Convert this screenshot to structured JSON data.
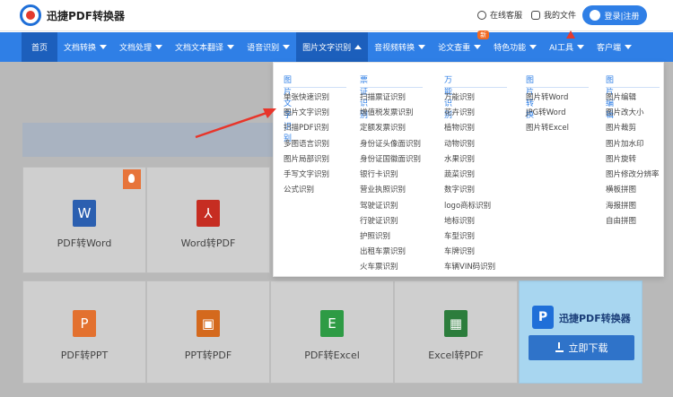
{
  "header": {
    "brand": "迅捷PDF转换器",
    "service": "在线客服",
    "my_files": "我的文件",
    "login": "登录|注册"
  },
  "nav": {
    "items": [
      {
        "label": "首页"
      },
      {
        "label": "文档转换"
      },
      {
        "label": "文档处理"
      },
      {
        "label": "文档文本翻译"
      },
      {
        "label": "语音识别"
      },
      {
        "label": "图片文字识别"
      },
      {
        "label": "音视频转换"
      },
      {
        "label": "论文查重"
      },
      {
        "label": "特色功能"
      },
      {
        "label": "AI工具"
      },
      {
        "label": "客户端"
      }
    ],
    "new_badge": "新"
  },
  "dropdown": {
    "columns": [
      {
        "title": "图片文字识别",
        "items": [
          "单张快速识别",
          "图片文字识别",
          "扫描PDF识别",
          "多图语言识别",
          "图片局部识别",
          "手写文字识别",
          "公式识别"
        ]
      },
      {
        "title": "票证识别",
        "items": [
          "扫描票证识别",
          "增值税发票识别",
          "定额发票识别",
          "身份证头像面识别",
          "身份证国徽面识别",
          "银行卡识别",
          "营业执照识别",
          "驾驶证识别",
          "行驶证识别",
          "护照识别",
          "出租车票识别",
          "火车票识别"
        ]
      },
      {
        "title": "万能识别",
        "items": [
          "万能识别",
          "花卉识别",
          "植物识别",
          "动物识别",
          "水果识别",
          "蔬菜识别",
          "数字识别",
          "logo商标识别",
          "地标识别",
          "车型识别",
          "车牌识别",
          "车辆VIN码识别"
        ]
      },
      {
        "title": "图片转换",
        "items": [
          "图片转Word",
          "JPG转Word",
          "图片转Excel"
        ]
      },
      {
        "title": "图片编辑",
        "items": [
          "图片编辑",
          "图片改大小",
          "图片裁剪",
          "图片加水印",
          "图片旋转",
          "图片修改分辨率",
          "横板拼图",
          "海报拼图",
          "自由拼图"
        ]
      }
    ]
  },
  "tools": [
    {
      "label": "PDF转Word",
      "icon": "W",
      "color": "#2b5fb0"
    },
    {
      "label": "Word转PDF",
      "icon": "⅄",
      "color": "#c62d22"
    },
    {
      "label": "PDF转PPT",
      "icon": "P",
      "color": "#e3712f"
    },
    {
      "label": "PPT转PDF",
      "icon": "▣",
      "color": "#d4691d"
    },
    {
      "label": "PDF转Excel",
      "icon": "E",
      "color": "#2e9b45"
    },
    {
      "label": "Excel转PDF",
      "icon": "▦",
      "color": "#2c7d3c"
    }
  ],
  "promo": {
    "title": "迅捷PDF转换器",
    "logo": "P",
    "download": "立即下载"
  }
}
